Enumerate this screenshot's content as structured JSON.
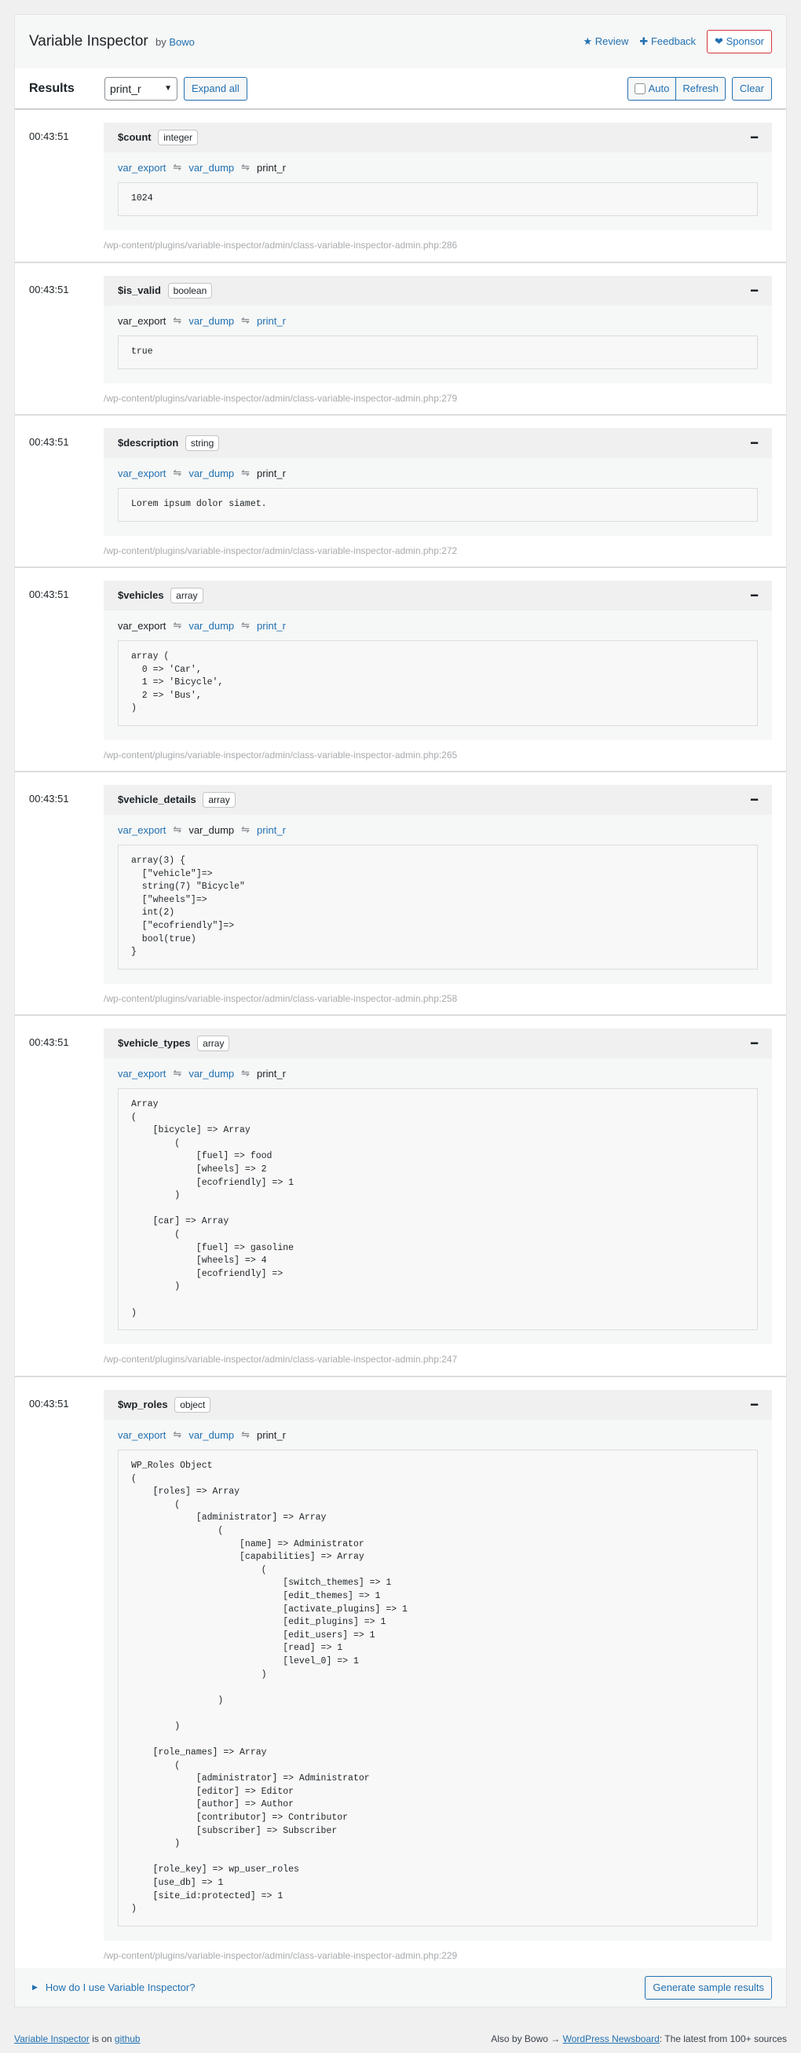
{
  "header": {
    "title": "Variable Inspector",
    "by_text": "by",
    "by_link": "Bowo",
    "review": "Review",
    "feedback": "Feedback",
    "sponsor": "Sponsor"
  },
  "toolbar": {
    "results_label": "Results",
    "select_value": "print_r",
    "expand_all": "Expand all",
    "auto": "Auto",
    "refresh": "Refresh",
    "clear": "Clear"
  },
  "formats": [
    "var_export",
    "var_dump",
    "print_r"
  ],
  "format_sep": "⇋",
  "results": [
    {
      "time": "00:43:51",
      "name": "$count",
      "type": "integer",
      "active_format": "print_r",
      "output": "1024",
      "path": "/wp-content/plugins/variable-inspector/admin/class-variable-inspector-admin.php:286"
    },
    {
      "time": "00:43:51",
      "name": "$is_valid",
      "type": "boolean",
      "active_format": "var_export",
      "output": "true",
      "path": "/wp-content/plugins/variable-inspector/admin/class-variable-inspector-admin.php:279"
    },
    {
      "time": "00:43:51",
      "name": "$description",
      "type": "string",
      "active_format": "print_r",
      "output": "Lorem ipsum dolor siamet.",
      "path": "/wp-content/plugins/variable-inspector/admin/class-variable-inspector-admin.php:272"
    },
    {
      "time": "00:43:51",
      "name": "$vehicles",
      "type": "array",
      "active_format": "var_export",
      "output": "array (\n  0 => 'Car',\n  1 => 'Bicycle',\n  2 => 'Bus',\n)",
      "path": "/wp-content/plugins/variable-inspector/admin/class-variable-inspector-admin.php:265"
    },
    {
      "time": "00:43:51",
      "name": "$vehicle_details",
      "type": "array",
      "active_format": "var_dump",
      "output": "array(3) {\n  [\"vehicle\"]=>\n  string(7) \"Bicycle\"\n  [\"wheels\"]=>\n  int(2)\n  [\"ecofriendly\"]=>\n  bool(true)\n}",
      "path": "/wp-content/plugins/variable-inspector/admin/class-variable-inspector-admin.php:258"
    },
    {
      "time": "00:43:51",
      "name": "$vehicle_types",
      "type": "array",
      "active_format": "print_r",
      "output": "Array\n(\n    [bicycle] => Array\n        (\n            [fuel] => food\n            [wheels] => 2\n            [ecofriendly] => 1\n        )\n\n    [car] => Array\n        (\n            [fuel] => gasoline\n            [wheels] => 4\n            [ecofriendly] =>\n        )\n\n)",
      "path": "/wp-content/plugins/variable-inspector/admin/class-variable-inspector-admin.php:247"
    },
    {
      "time": "00:43:51",
      "name": "$wp_roles",
      "type": "object",
      "active_format": "print_r",
      "output": "WP_Roles Object\n(\n    [roles] => Array\n        (\n            [administrator] => Array\n                (\n                    [name] => Administrator\n                    [capabilities] => Array\n                        (\n                            [switch_themes] => 1\n                            [edit_themes] => 1\n                            [activate_plugins] => 1\n                            [edit_plugins] => 1\n                            [edit_users] => 1\n                            [read] => 1\n                            [level_0] => 1\n                        )\n\n                )\n\n        )\n\n    [role_names] => Array\n        (\n            [administrator] => Administrator\n            [editor] => Editor\n            [author] => Author\n            [contributor] => Contributor\n            [subscriber] => Subscriber\n        )\n\n    [role_key] => wp_user_roles\n    [use_db] => 1\n    [site_id:protected] => 1\n)",
      "path": "/wp-content/plugins/variable-inspector/admin/class-variable-inspector-admin.php:229"
    }
  ],
  "footer": {
    "howto": "How do I use Variable Inspector?",
    "generate": "Generate sample results"
  },
  "credits": {
    "left_link": "Variable Inspector",
    "left_mid": "is on",
    "left_link2": "github",
    "right_text": "Also by Bowo →",
    "right_link": "WordPress Newsboard",
    "right_tail": ": The latest from 100+ sources"
  },
  "colors": {
    "accent": "#2271b1",
    "sponsor": "#d63638",
    "muted": "#a7aaad"
  }
}
